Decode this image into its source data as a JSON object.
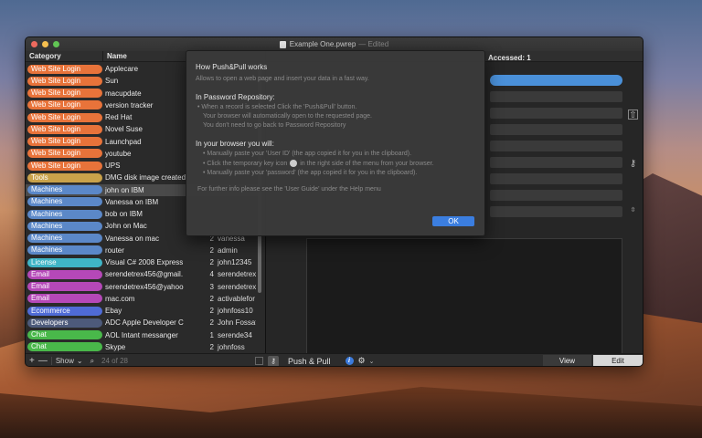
{
  "window": {
    "title": "Example One.pwrep",
    "status": "— Edited"
  },
  "list": {
    "col_category": "Category",
    "col_name": "Name",
    "rows": [
      {
        "category": "Web Site Login",
        "color": "#e8733a",
        "name": "Applecare",
        "num": "",
        "user": ""
      },
      {
        "category": "Web Site Login",
        "color": "#e8733a",
        "name": "Sun",
        "num": "",
        "user": ""
      },
      {
        "category": "Web Site Login",
        "color": "#e8733a",
        "name": "macupdate",
        "num": "",
        "user": ""
      },
      {
        "category": "Web Site Login",
        "color": "#e8733a",
        "name": "version tracker",
        "num": "",
        "user": ""
      },
      {
        "category": "Web Site Login",
        "color": "#e8733a",
        "name": "Red Hat",
        "num": "",
        "user": ""
      },
      {
        "category": "Web Site Login",
        "color": "#e8733a",
        "name": "Novel Suse",
        "num": "",
        "user": ""
      },
      {
        "category": "Web Site Login",
        "color": "#e8733a",
        "name": "Launchpad",
        "num": "",
        "user": ""
      },
      {
        "category": "Web Site Login",
        "color": "#e8733a",
        "name": "youtube",
        "num": "",
        "user": ""
      },
      {
        "category": "Web Site Login",
        "color": "#e8733a",
        "name": "UPS",
        "num": "",
        "user": ""
      },
      {
        "category": "Tools",
        "color": "#c9a24a",
        "name": "DMG disk image created",
        "num": "",
        "user": ""
      },
      {
        "category": "Machines",
        "color": "#5b88c8",
        "name": "john on IBM",
        "num": "",
        "user": "",
        "selected": true
      },
      {
        "category": "Machines",
        "color": "#5b88c8",
        "name": "Vanessa on IBM",
        "num": "",
        "user": ""
      },
      {
        "category": "Machines",
        "color": "#5b88c8",
        "name": "bob on IBM",
        "num": "",
        "user": ""
      },
      {
        "category": "Machines",
        "color": "#5b88c8",
        "name": "John on Mac",
        "num": "",
        "user": ""
      },
      {
        "category": "Machines",
        "color": "#5b88c8",
        "name": "Vanessa on mac",
        "num": "2",
        "user": "vanessa"
      },
      {
        "category": "Machines",
        "color": "#5b88c8",
        "name": "router",
        "num": "2",
        "user": "admin"
      },
      {
        "category": "License",
        "color": "#3fb5c6",
        "name": "Visual C# 2008 Express",
        "num": "2",
        "user": "john12345"
      },
      {
        "category": "Email",
        "color": "#b548b8",
        "name": "serendetrex456@gmail.",
        "num": "4",
        "user": "serendetrex"
      },
      {
        "category": "Email",
        "color": "#b548b8",
        "name": "serendetrex456@yahoo",
        "num": "3",
        "user": "serendetrex"
      },
      {
        "category": "Email",
        "color": "#b548b8",
        "name": "mac.com",
        "num": "2",
        "user": "activablefor"
      },
      {
        "category": "Ecommerce",
        "color": "#4f6bd6",
        "name": "Ebay",
        "num": "2",
        "user": "johnfoss10"
      },
      {
        "category": "Developers",
        "color": "#4d5a7a",
        "name": "ADC Apple Developer C",
        "num": "2",
        "user": "John Fossat"
      },
      {
        "category": "Chat",
        "color": "#49b84a",
        "name": "AOL Intant messanger",
        "num": "1",
        "user": "serende34"
      },
      {
        "category": "Chat",
        "color": "#49b84a",
        "name": "Skype",
        "num": "2",
        "user": "johnfoss"
      }
    ]
  },
  "left_toolbar": {
    "add": "+",
    "remove": "—",
    "show": "Show",
    "counter": "24 of 28"
  },
  "detail": {
    "accessed": "Accessed: 1"
  },
  "right_toolbar": {
    "push_pull": "Push & Pull",
    "view": "View",
    "edit": "Edit"
  },
  "dialog": {
    "title": "How Push&Pull works",
    "subtitle": "Allows to open a web page and insert your data in a fast way.",
    "section1": "In Password Repository:",
    "s1_line1": "• When a record is selected Click the 'Push&Pull' button.",
    "s1_line2": "Your browser will automatically open to the requested page.",
    "s1_line3": "You don't need to go back to Password Repository",
    "section2": "In your browser you will:",
    "s2_line1": "• Manually paste your 'User ID' (the app copied it for you in the clipboard).",
    "s2_line2a": "• Click the temporary key icon",
    "s2_line2b": "in the right side of the menu from your browser.",
    "s2_line3": "• Manually paste your 'password' (the app copied it for you in the clipboard).",
    "footer": "For further info please see the 'User Guide' under the Help menu",
    "ok": "OK"
  }
}
